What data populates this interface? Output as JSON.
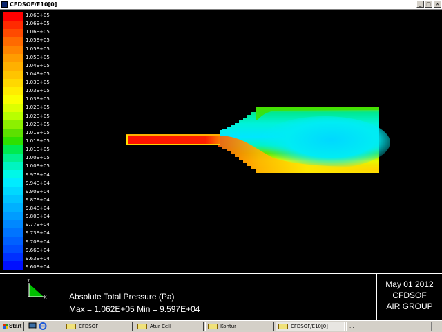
{
  "window": {
    "title": "CFDSOF/E10[0]",
    "buttons": {
      "minimize": "_",
      "maximize": "□",
      "close": "×"
    }
  },
  "legend": {
    "labels": [
      "1.06E+05",
      "1.06E+05",
      "1.06E+05",
      "1.05E+05",
      "1.05E+05",
      "1.05E+05",
      "1.04E+05",
      "1.04E+05",
      "1.03E+05",
      "1.03E+05",
      "1.03E+05",
      "1.02E+05",
      "1.02E+05",
      "1.02E+05",
      "1.01E+05",
      "1.01E+05",
      "1.01E+05",
      "1.00E+05",
      "1.00E+05",
      "9.97E+04",
      "9.94E+04",
      "9.90E+04",
      "9.87E+04",
      "9.84E+04",
      "9.80E+04",
      "9.77E+04",
      "9.73E+04",
      "9.70E+04",
      "9.66E+04",
      "9.63E+04",
      "9.60E+04"
    ],
    "colors": [
      "#ff0000",
      "#ff2a00",
      "#ff4a00",
      "#ff6a00",
      "#ff8400",
      "#ff9c00",
      "#ffb000",
      "#ffc400",
      "#ffd800",
      "#ffec00",
      "#faff00",
      "#dcff00",
      "#b8ff00",
      "#8cf000",
      "#5ce000",
      "#2ee000",
      "#00ea50",
      "#00f090",
      "#00f4c0",
      "#00f8e8",
      "#00ecff",
      "#00d8ff",
      "#00c4ff",
      "#00b0ff",
      "#009cff",
      "#0088ff",
      "#0074ff",
      "#0060ff",
      "#004cff",
      "#0030ff",
      "#0010ff"
    ]
  },
  "info": {
    "axis_y": "Y",
    "axis_x": "X",
    "variable": "Absolute Total Pressure (Pa)",
    "range": "Max = 1.062E+05   Min = 9.597E+04",
    "date": "May 01 2012",
    "org_line1": "CFDSOF",
    "org_line2": "AIR GROUP"
  },
  "taskbar": {
    "start": "Start",
    "tasks": [
      "CFDSOF",
      "Atur Cell",
      "Kontur",
      "CFDSOF/E10[0]",
      "..."
    ]
  }
}
